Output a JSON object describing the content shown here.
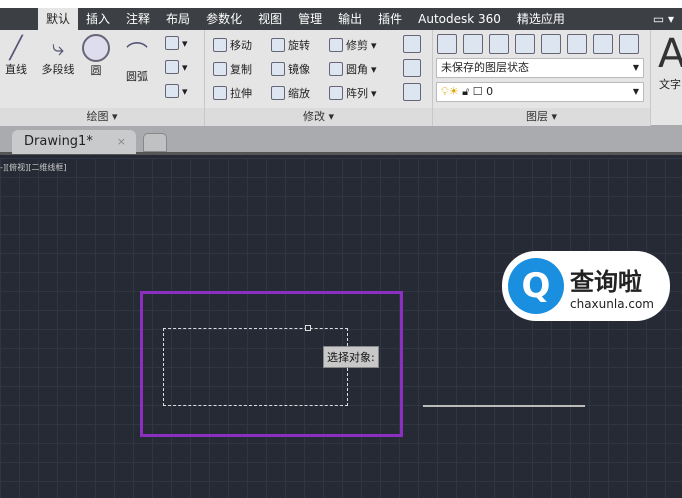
{
  "ribbon_tabs": [
    "默认",
    "插入",
    "注释",
    "布局",
    "参数化",
    "视图",
    "管理",
    "输出",
    "插件",
    "Autodesk 360",
    "精选应用"
  ],
  "draw": {
    "label": "绘图 ▾",
    "line": "直线",
    "polyline": "多段线",
    "circle": "圆",
    "arc": "圆弧"
  },
  "modify": {
    "label": "修改 ▾",
    "move": "移动",
    "rotate": "旋转",
    "trim": "修剪",
    "copy": "复制",
    "mirror": "镜像",
    "fillet": "圆角",
    "stretch": "拉伸",
    "scale": "缩放",
    "array": "阵列"
  },
  "layers": {
    "label": "图层 ▾",
    "state": "未保存的图层状态",
    "current": "0"
  },
  "text": {
    "big": "A",
    "label": "文字"
  },
  "doc_tab": {
    "title": "Drawing1*",
    "close": "×"
  },
  "viewport_label": "-][俯视][二维线框]",
  "tooltip": "选择对象:",
  "watermark": {
    "title": "查询啦",
    "url": "chaxunla.com",
    "logo": "Q"
  },
  "colors": {
    "selection": "#8a2fc0",
    "canvas": "#252a35"
  }
}
